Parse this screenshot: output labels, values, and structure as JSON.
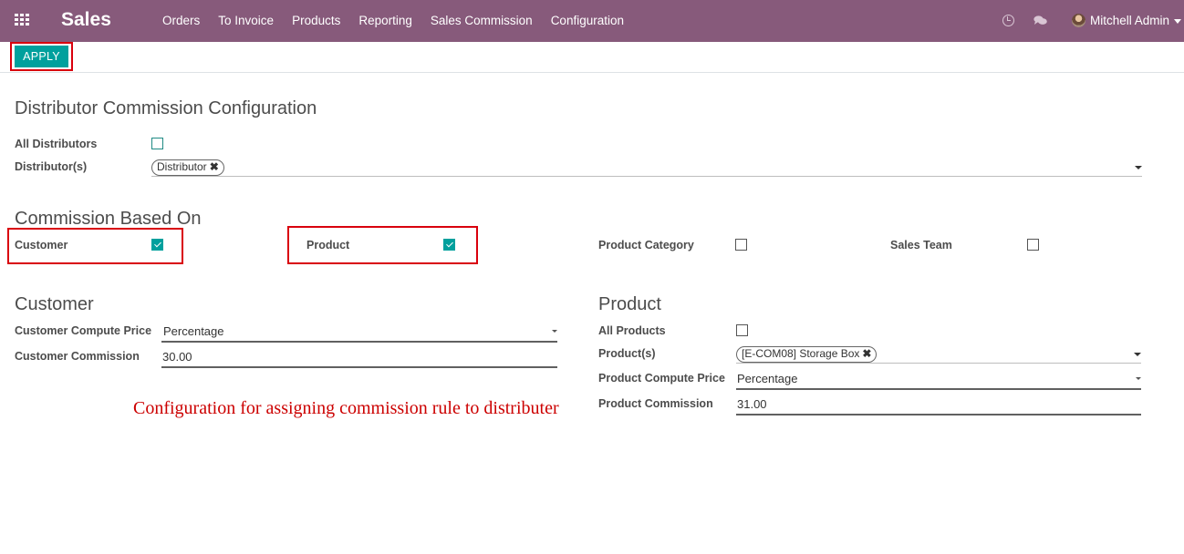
{
  "navbar": {
    "brand": "Sales",
    "menu": [
      "Orders",
      "To Invoice",
      "Products",
      "Reporting",
      "Sales Commission",
      "Configuration"
    ],
    "user": "Mitchell Admin",
    "icons": [
      "apps-icon",
      "clock-icon",
      "chat-icon",
      "avatar",
      "caret-down-icon"
    ]
  },
  "toolbar": {
    "apply_label": "APPLY"
  },
  "form": {
    "title": "Distributor Commission Configuration",
    "all_distributors": {
      "label": "All Distributors",
      "checked": false
    },
    "distributors": {
      "label": "Distributor(s)",
      "tags": [
        "Distributor"
      ]
    },
    "commission_based_on": {
      "title": "Commission Based On",
      "customer": {
        "label": "Customer",
        "checked": true
      },
      "product": {
        "label": "Product",
        "checked": true
      },
      "product_category": {
        "label": "Product Category",
        "checked": false
      },
      "sales_team": {
        "label": "Sales Team",
        "checked": false
      }
    },
    "customer_section": {
      "title": "Customer",
      "compute_price_label": "Customer Compute Price",
      "compute_price_value": "Percentage",
      "commission_label": "Customer Commission",
      "commission_value": "30.00"
    },
    "product_section": {
      "title": "Product",
      "all_products_label": "All Products",
      "all_products_checked": false,
      "products_label": "Product(s)",
      "products_tags": [
        "[E-COM08] Storage Box"
      ],
      "compute_price_label": "Product Compute Price",
      "compute_price_value": "Percentage",
      "commission_label": "Product Commission",
      "commission_value": "31.00"
    }
  },
  "annotation": {
    "caption": "Configuration for assigning commission rule to distributer",
    "highlight_color": "#d9000d"
  },
  "colors": {
    "navbar": "#875a7b",
    "primary_button": "#00a09d"
  }
}
